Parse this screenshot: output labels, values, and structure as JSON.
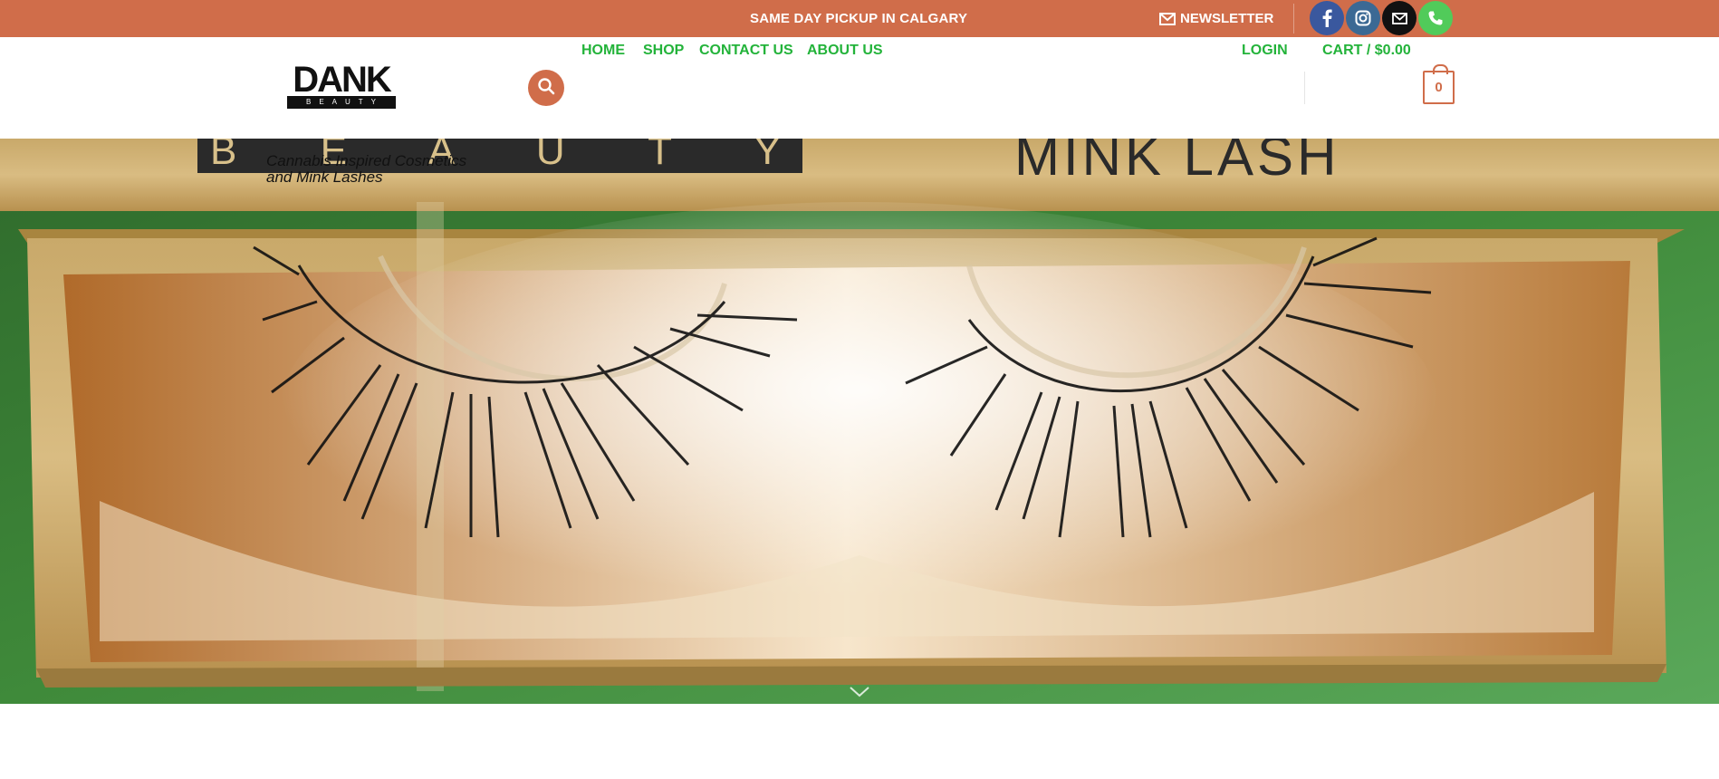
{
  "topbar": {
    "promo_text": "SAME DAY PICKUP IN CALGARY",
    "newsletter_label": "NEWSLETTER",
    "social_icons": [
      "facebook-icon",
      "instagram-icon",
      "email-icon",
      "phone-icon"
    ],
    "background_color": "#d06d4a"
  },
  "header": {
    "logo": {
      "word": "DANK",
      "subword": "BEAUTY"
    },
    "tagline_line1": "Cannabis Inspired Cosmetics",
    "tagline_line2": "and Mink Lashes",
    "nav": [
      "HOME",
      "SHOP",
      "CONTACT US",
      "ABOUT US"
    ],
    "login_label": "LOGIN",
    "cart_label": "CART / $0.00",
    "cart_count": "0",
    "link_color": "#23b33a",
    "accent_color": "#d06d4a"
  },
  "hero": {
    "box_text_left": "B E A U T Y",
    "box_text_right": "MINK LASH",
    "image_subject": "mink lashes in a gold box"
  }
}
